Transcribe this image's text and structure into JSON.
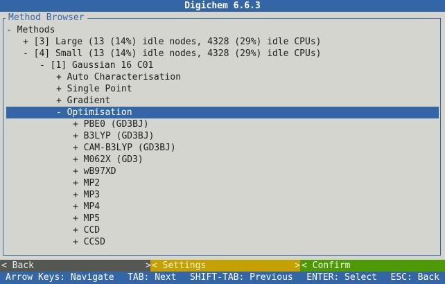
{
  "app": {
    "title": "Digichem 6.6.3"
  },
  "panel": {
    "title": "Method Browser"
  },
  "tree": [
    {
      "indent": 0,
      "marker": "-",
      "label": "Methods"
    },
    {
      "indent": 1,
      "marker": "+",
      "label": "[3] Large (13 (14%) idle nodes, 4328 (29%) idle CPUs)"
    },
    {
      "indent": 1,
      "marker": "-",
      "label": "[4] Small (13 (14%) idle nodes, 4328 (29%) idle CPUs)"
    },
    {
      "indent": 2,
      "marker": "-",
      "label": "[1] Gaussian 16 C01"
    },
    {
      "indent": 3,
      "marker": "+",
      "label": "Auto Characterisation"
    },
    {
      "indent": 3,
      "marker": "+",
      "label": "Single Point"
    },
    {
      "indent": 3,
      "marker": "+",
      "label": "Gradient"
    },
    {
      "indent": 3,
      "marker": "-",
      "label": "Optimisation",
      "selected": true
    },
    {
      "indent": 4,
      "marker": "+",
      "label": "PBE0 (GD3BJ)"
    },
    {
      "indent": 4,
      "marker": "+",
      "label": "B3LYP (GD3BJ)"
    },
    {
      "indent": 4,
      "marker": "+",
      "label": "CAM-B3LYP (GD3BJ)"
    },
    {
      "indent": 4,
      "marker": "+",
      "label": "M062X (GD3)"
    },
    {
      "indent": 4,
      "marker": "+",
      "label": "wB97XD"
    },
    {
      "indent": 4,
      "marker": "+",
      "label": "MP2"
    },
    {
      "indent": 4,
      "marker": "+",
      "label": "MP3"
    },
    {
      "indent": 4,
      "marker": "+",
      "label": "MP4"
    },
    {
      "indent": 4,
      "marker": "+",
      "label": "MP5"
    },
    {
      "indent": 4,
      "marker": "+",
      "label": "CCD"
    },
    {
      "indent": 4,
      "marker": "+",
      "label": "CCSD"
    }
  ],
  "buttons": {
    "back": "< Back",
    "settings": "< Settings",
    "confirm": "< Confirm",
    "back_end": ">",
    "settings_end": ">"
  },
  "help": {
    "arrows": "Arrow Keys: Navigate",
    "tab": "TAB: Next",
    "shift_tab": "SHIFT-TAB: Previous",
    "enter": "ENTER: Select",
    "esc": "ESC: Back"
  },
  "colors": {
    "background": "#d4d5cf",
    "accent": "#3465a4",
    "back_button": "#555753",
    "settings_button": "#c4a000",
    "confirm_button": "#4e9a06"
  }
}
